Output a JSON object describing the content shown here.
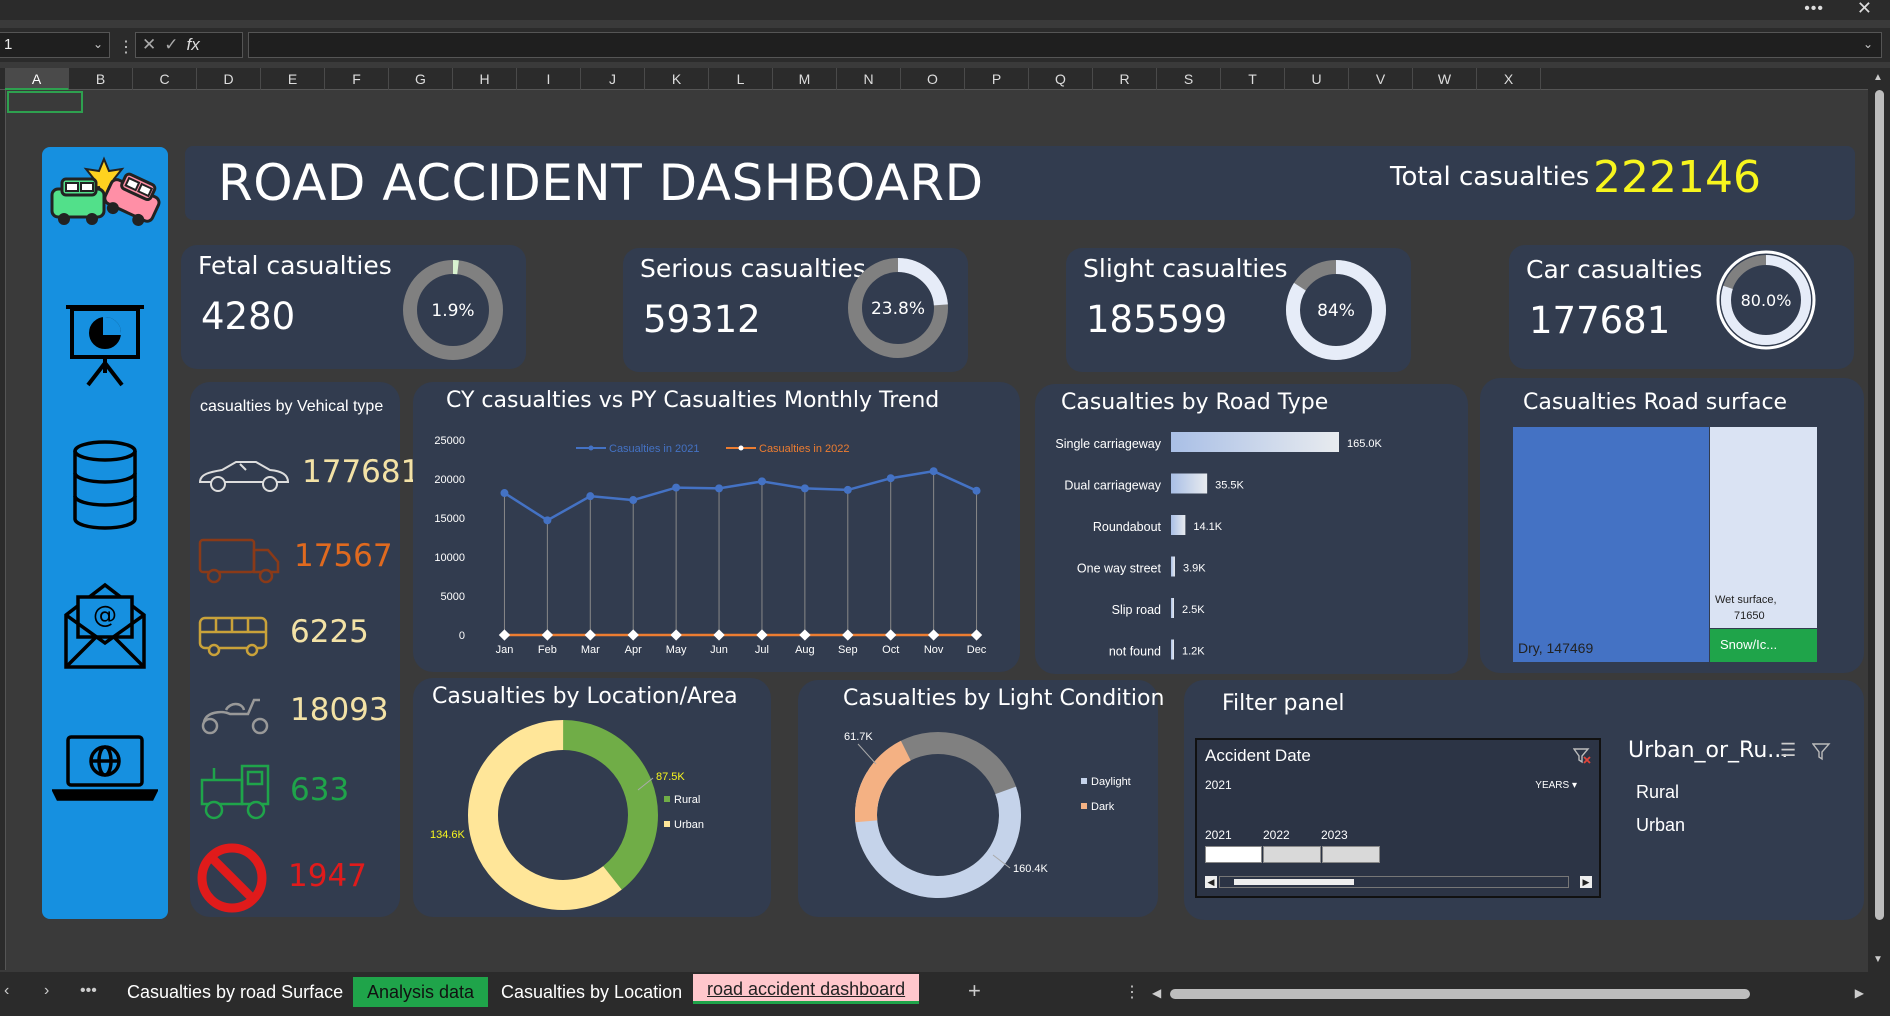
{
  "window": {
    "more_icon": "ellipsis-icon",
    "close_icon": "close-icon"
  },
  "formula_bar": {
    "name_box": "1",
    "fx_label": "fx",
    "formula": ""
  },
  "columns": [
    "A",
    "B",
    "C",
    "D",
    "E",
    "F",
    "G",
    "H",
    "I",
    "J",
    "K",
    "L",
    "M",
    "N",
    "O",
    "P",
    "Q",
    "R",
    "S",
    "T",
    "U",
    "V",
    "W",
    "X"
  ],
  "selected_column": "A",
  "sidebar": {
    "background": "#1690e0",
    "icons": [
      "car-crash-icon",
      "presentation-chart-icon",
      "database-icon",
      "email-envelope-icon",
      "laptop-globe-icon"
    ]
  },
  "header": {
    "title": "ROAD ACCIDENT DASHBOARD",
    "total_label": "Total casualties",
    "total_value": "222146",
    "total_color": "#f7f51e"
  },
  "kpis": [
    {
      "label": "Fetal casualties",
      "value": "4280",
      "pct_label": "1.9%",
      "pct": 0.019
    },
    {
      "label": "Serious casualties",
      "value": "59312",
      "pct_label": "23.8%",
      "pct": 0.238
    },
    {
      "label": "Slight casualties",
      "value": "185599",
      "pct_label": "84%",
      "pct": 0.84
    },
    {
      "label": "Car casualties",
      "value": "177681",
      "pct_label": "80.0%",
      "pct": 0.8
    }
  ],
  "vehicle_type": {
    "title": "casualties by Vehical type",
    "rows": [
      {
        "icon": "car-icon",
        "value": "177681",
        "color": "#f3e2a6"
      },
      {
        "icon": "truck-icon",
        "value": "17567",
        "color": "#e06a1f"
      },
      {
        "icon": "bus-icon",
        "value": "6225",
        "color": "#f3e2a6"
      },
      {
        "icon": "scooter-icon",
        "value": "18093",
        "color": "#f3e2a6"
      },
      {
        "icon": "tractor-icon",
        "value": "633",
        "color": "#1fa44a"
      },
      {
        "icon": "no-entry-icon",
        "value": "1947",
        "color": "#e01b1b"
      }
    ]
  },
  "trend": {
    "title": "CY casualties vs PY Casualties Monthly Trend",
    "chart_data": {
      "type": "line",
      "categories": [
        "Jan",
        "Feb",
        "Mar",
        "Apr",
        "May",
        "Jun",
        "Jul",
        "Aug",
        "Sep",
        "Oct",
        "Nov",
        "Dec"
      ],
      "series": [
        {
          "name": "Casualties in 2021",
          "color": "#4472c4",
          "values": [
            18200,
            14700,
            17800,
            17300,
            18900,
            18800,
            19700,
            18800,
            18600,
            20100,
            21000,
            18500
          ]
        },
        {
          "name": "Casualties in 2022",
          "color": "#ed7d31",
          "values": [
            0,
            0,
            0,
            0,
            0,
            0,
            0,
            0,
            0,
            0,
            0,
            0
          ]
        }
      ],
      "yticks": [
        "0",
        "5000",
        "10000",
        "15000",
        "20000",
        "25000"
      ],
      "ylim": [
        0,
        25000
      ]
    }
  },
  "road_type": {
    "title": "Casualties by Road Type",
    "chart_data": {
      "type": "bar",
      "categories": [
        "Single carriageway",
        "Dual carriageway",
        "Roundabout",
        "One way street",
        "Slip road",
        "not found"
      ],
      "values": [
        165.0,
        35.5,
        14.1,
        3.9,
        2.5,
        1.2
      ],
      "labels": [
        "165.0K",
        "35.5K",
        "14.1K",
        "3.9K",
        "2.5K",
        "1.2K"
      ]
    }
  },
  "surface": {
    "title": "Casualties Road surface",
    "chart_data": {
      "type": "treemap",
      "items": [
        {
          "label": "Dry, 147469",
          "value": 147469,
          "color": "#4472c4"
        },
        {
          "label": "Wet surface,",
          "label2": "71650",
          "value": 71650,
          "color": "#dae3f3"
        },
        {
          "label": "Snow/Ic...",
          "value": 3027,
          "color": "#1fa44a"
        }
      ]
    }
  },
  "location": {
    "title": "Casualties by Location/Area",
    "chart_data": {
      "type": "pie",
      "slices": [
        {
          "name": "Rural",
          "value": 87.5,
          "label": "87.5K",
          "color": "#70ad47"
        },
        {
          "name": "Urban",
          "value": 134.6,
          "label": "134.6K",
          "color": "#ffe699"
        }
      ]
    }
  },
  "light": {
    "title": "Casualties by Light Condition",
    "chart_data": {
      "type": "pie",
      "slices": [
        {
          "name": "Daylight",
          "value": 160.4,
          "label": "160.4K",
          "color": "#c5d3ea"
        },
        {
          "name": "Dark",
          "value": 61.7,
          "label": "61.7K",
          "color": "#f4b183"
        }
      ]
    }
  },
  "filter": {
    "title": "Filter panel",
    "slicer": {
      "header": "Accident Date",
      "selected": "2021",
      "level": "YEARS",
      "years": [
        "2021",
        "2022",
        "2023"
      ]
    },
    "urban": {
      "header": "Urban_or_Ru...",
      "items": [
        "Rural",
        "Urban"
      ]
    }
  },
  "sheet_tabs": [
    {
      "label": "Casualties by road Surface",
      "style": "normal"
    },
    {
      "label": "Analysis data",
      "style": "green"
    },
    {
      "label": "Casualties by Location",
      "style": "normal"
    },
    {
      "label": "road accident dashboard",
      "style": "active"
    }
  ],
  "add_sheet": "+"
}
